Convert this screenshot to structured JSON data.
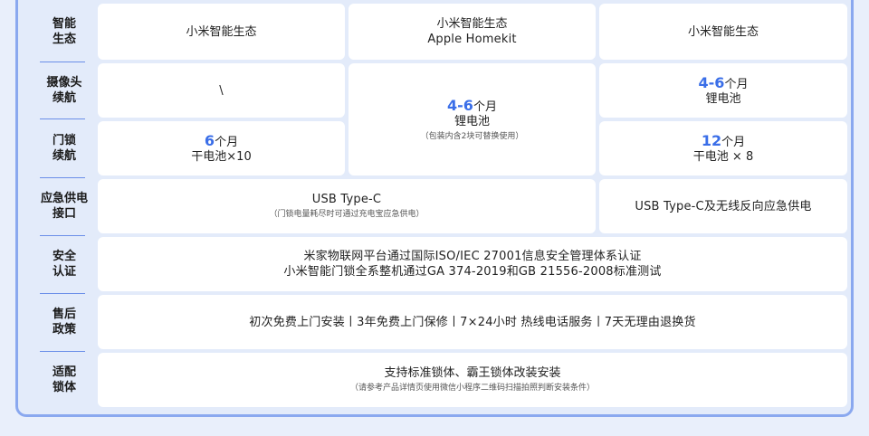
{
  "rows": {
    "ecosystem": {
      "label1": "智能",
      "label2": "生态",
      "col1": "小米智能生态",
      "col2_line1": "小米智能生态",
      "col2_line2": "Apple Homekit",
      "col3": "小米智能生态"
    },
    "camera": {
      "label1": "摄像头",
      "label2": "续航",
      "col1": "\\",
      "col3_value": "4-6",
      "col3_unit": "个月",
      "col3_battery": "锂电池"
    },
    "shared_col2": {
      "value": "4-6",
      "unit": "个月",
      "battery": "锂电池",
      "note": "（包装内含2块可替换使用）"
    },
    "lock": {
      "label1": "门锁",
      "label2": "续航",
      "col1_value": "6",
      "col1_unit": "个月",
      "col1_battery": "干电池×10",
      "col3_value": "12",
      "col3_unit": "个月",
      "col3_battery": "干电池 × 8"
    },
    "emergency": {
      "label1": "应急供电",
      "label2": "接口",
      "col12_main": "USB Type-C",
      "col12_note": "（门锁电量耗尽时可通过充电宝应急供电）",
      "col3": "USB Type-C及无线反向应急供电"
    },
    "security": {
      "label1": "安全",
      "label2": "认证",
      "line1": "米家物联网平台通过国际ISO/IEC 27001信息安全管理体系认证",
      "line2": "小米智能门锁全系整机通过GA 374-2019和GB 21556-2008标准测试"
    },
    "aftersales": {
      "label1": "售后",
      "label2": "政策",
      "text": "初次免费上门安装丨3年免费上门保修丨7×24小时 热线电话服务丨7天无理由退换货"
    },
    "lockbody": {
      "label1": "适配",
      "label2": "锁体",
      "main": "支持标准锁体、霸王锁体改装安装",
      "note": "（请参考产品详情页使用微信小程序二维码扫描拍照判断安装条件）"
    }
  }
}
